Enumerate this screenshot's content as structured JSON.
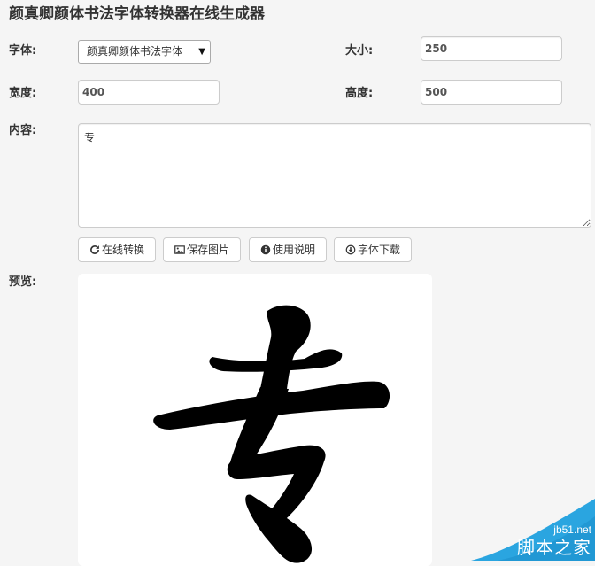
{
  "header": {
    "title": "颜真卿颜体书法字体转换器在线生成器"
  },
  "form": {
    "font": {
      "label": "字体:",
      "selected": "颜真卿颜体书法字体"
    },
    "size": {
      "label": "大小:",
      "value": "250"
    },
    "width": {
      "label": "宽度:",
      "value": "400"
    },
    "height": {
      "label": "高度:",
      "value": "500"
    },
    "content": {
      "label": "内容:",
      "value": "专"
    }
  },
  "buttons": {
    "convert": "在线转换",
    "save_image": "保存图片",
    "instructions": "使用说明",
    "download_font": "字体下载"
  },
  "preview": {
    "label": "预览:",
    "glyph": "专"
  },
  "watermark": {
    "url": "jb51.net",
    "name": "脚本之家"
  },
  "colors": {
    "page_background": "#f5f5f5",
    "watermark_blue": "#2aa5e0"
  },
  "icons": {
    "convert": "refresh-icon",
    "save_image": "picture-icon",
    "instructions": "info-circle-icon",
    "download_font": "download-circle-icon"
  }
}
